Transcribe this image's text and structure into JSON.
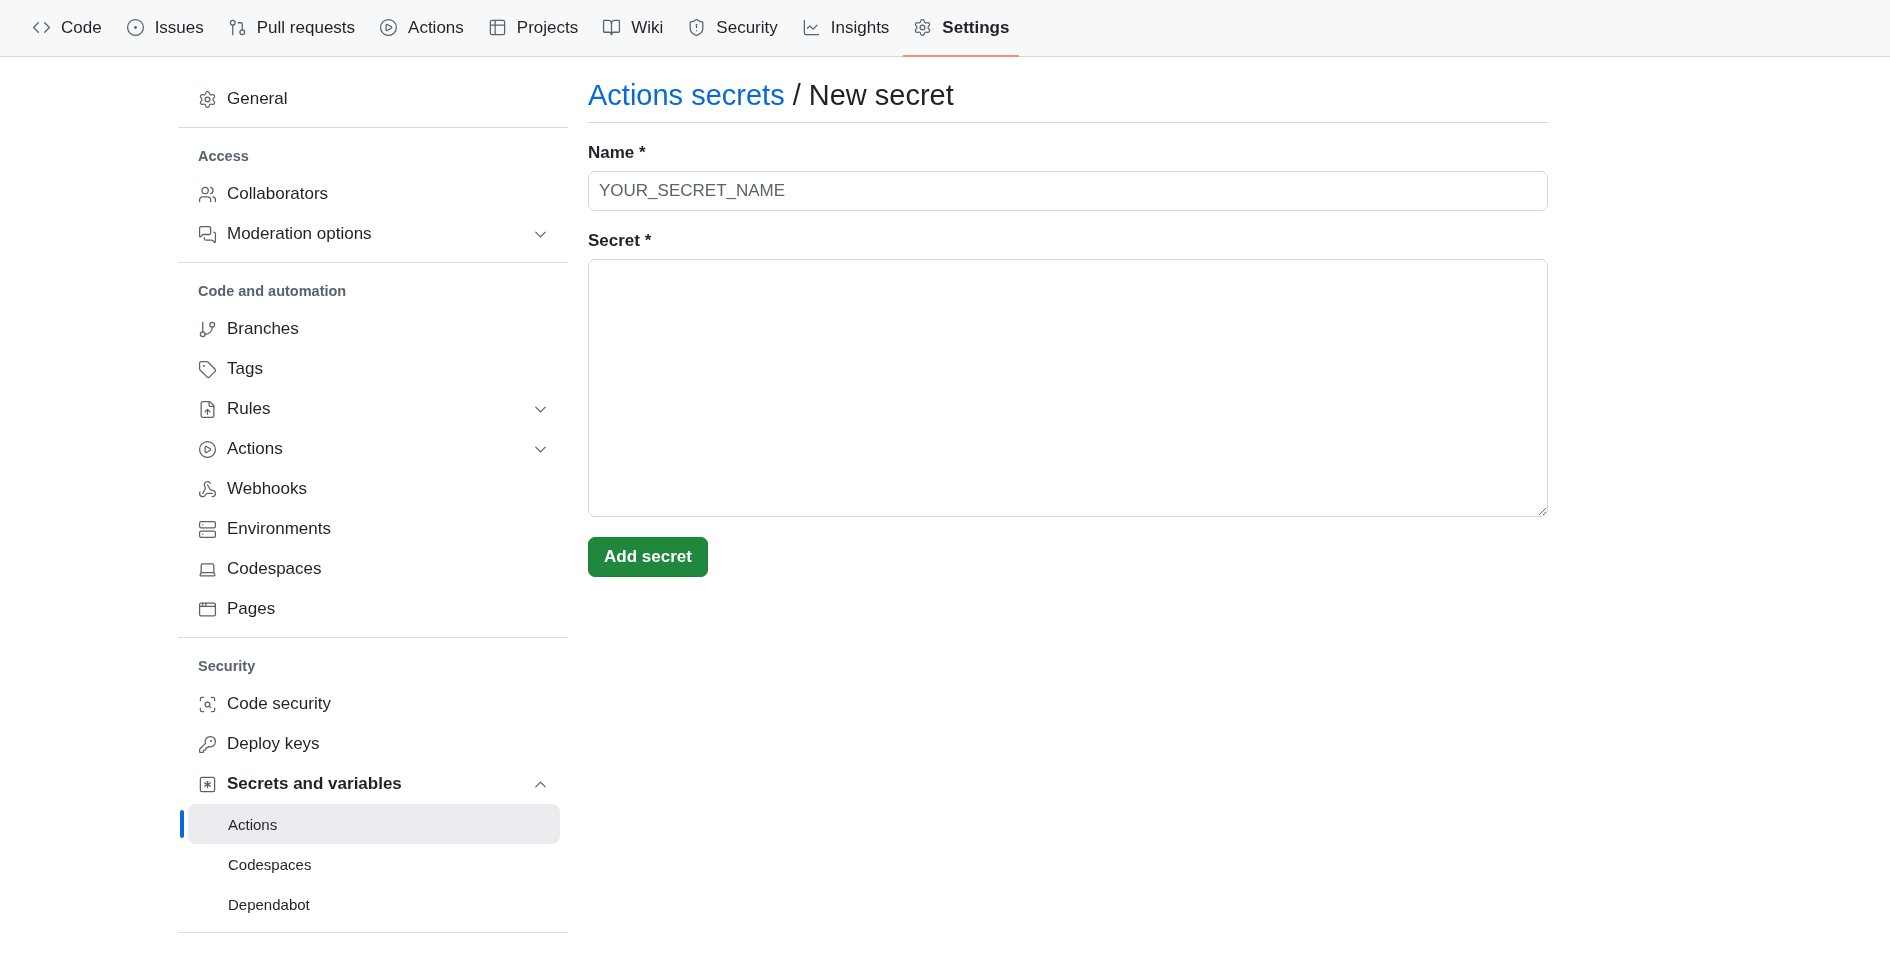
{
  "nav_tabs": [
    {
      "label": "Code",
      "selected": false
    },
    {
      "label": "Issues",
      "selected": false
    },
    {
      "label": "Pull requests",
      "selected": false
    },
    {
      "label": "Actions",
      "selected": false
    },
    {
      "label": "Projects",
      "selected": false
    },
    {
      "label": "Wiki",
      "selected": false
    },
    {
      "label": "Security",
      "selected": false
    },
    {
      "label": "Insights",
      "selected": false
    },
    {
      "label": "Settings",
      "selected": true
    }
  ],
  "sidebar": {
    "sections": [
      {
        "items": [
          {
            "label": "General",
            "selected": false
          }
        ]
      },
      {
        "heading": "Access",
        "items": [
          {
            "label": "Collaborators",
            "selected": false
          },
          {
            "label": "Moderation options",
            "selected": false,
            "expanded": false
          }
        ]
      },
      {
        "heading": "Code and automation",
        "items": [
          {
            "label": "Branches",
            "selected": false
          },
          {
            "label": "Tags",
            "selected": false
          },
          {
            "label": "Rules",
            "selected": false,
            "expanded": false
          },
          {
            "label": "Actions",
            "selected": false,
            "expanded": false
          },
          {
            "label": "Webhooks",
            "selected": false
          },
          {
            "label": "Environments",
            "selected": false
          },
          {
            "label": "Codespaces",
            "selected": false
          },
          {
            "label": "Pages",
            "selected": false
          }
        ]
      },
      {
        "heading": "Security",
        "items": [
          {
            "label": "Code security",
            "selected": false
          },
          {
            "label": "Deploy keys",
            "selected": false
          },
          {
            "label": "Secrets and variables",
            "selected": false,
            "expanded": true,
            "children": [
              {
                "label": "Actions",
                "selected": true
              },
              {
                "label": "Codespaces",
                "selected": false
              },
              {
                "label": "Dependabot",
                "selected": false
              }
            ]
          }
        ]
      }
    ]
  },
  "form": {
    "breadcrumb_link": "Actions secrets",
    "separator": "/",
    "title": "New secret",
    "name_label": "Name *",
    "name_placeholder": "YOUR_SECRET_NAME",
    "secret_label": "Secret *",
    "submit_button": "Add secret"
  }
}
